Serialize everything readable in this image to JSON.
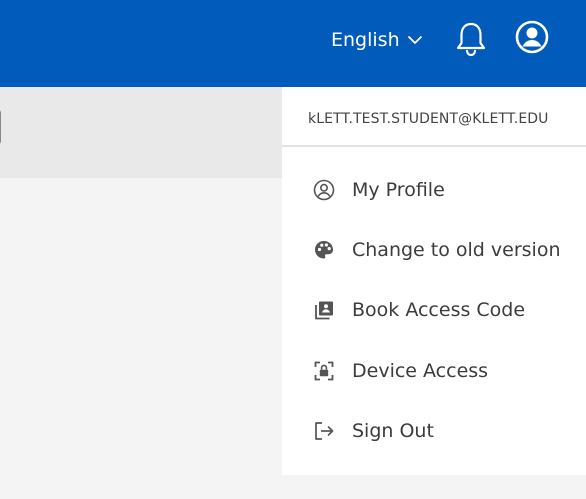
{
  "header": {
    "language_label": "English",
    "language_icon": "chevron-down-icon",
    "notifications_icon": "bell-icon",
    "account_icon": "account-circle-icon",
    "brand_color": "#005bbb"
  },
  "dropdown": {
    "email": "kLETT.TEST.STUDENT@KLETT.EDU",
    "items": [
      {
        "label": "My Profile",
        "icon": "profile-icon"
      },
      {
        "label": "Change to old version",
        "icon": "palette-icon"
      },
      {
        "label": "Book Access Code",
        "icon": "book-access-icon"
      },
      {
        "label": "Device Access",
        "icon": "device-lock-icon"
      },
      {
        "label": "Sign Out",
        "icon": "sign-out-icon"
      }
    ]
  }
}
